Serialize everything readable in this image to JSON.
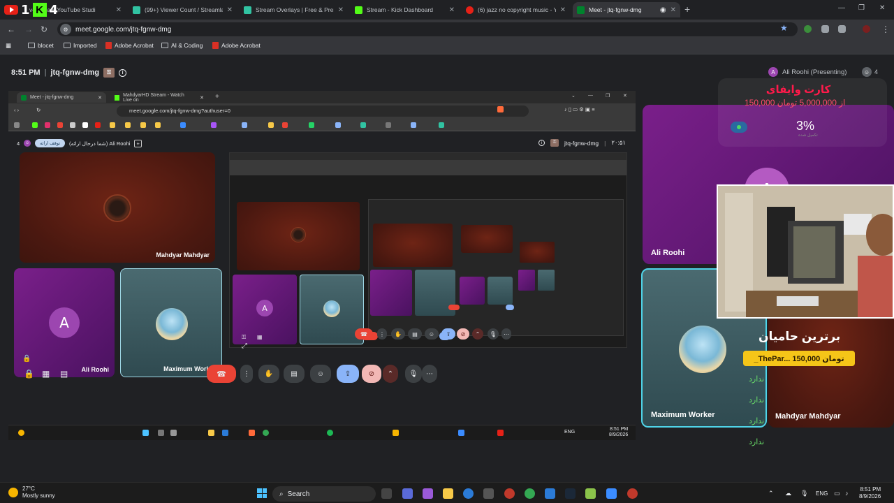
{
  "browser": {
    "tabs": [
      {
        "label": "ve stream YouTube Studi"
      },
      {
        "label": "(99+) Viewer Count / Streamlab"
      },
      {
        "label": "Stream Overlays | Free & Premiu"
      },
      {
        "label": "Stream - Kick Dashboard"
      },
      {
        "label": "(6) jazz no copyright music - Yo"
      },
      {
        "label": "Meet - jtq-fgnw-dmg"
      }
    ],
    "overlay_counts": {
      "youtube": "1",
      "kick": "4"
    },
    "url": "meet.google.com/jtq-fgnw-dmg",
    "bookmarks": [
      {
        "label": "blocet",
        "icon": "folder-icon"
      },
      {
        "label": "Imported",
        "icon": "folder-icon"
      },
      {
        "label": "Adobe Acrobat",
        "icon": "acrobat-icon"
      },
      {
        "label": "AI & Coding",
        "icon": "folder-icon"
      },
      {
        "label": "Adobe Acrobat",
        "icon": "acrobat-icon"
      }
    ]
  },
  "meet": {
    "time": "8:51 PM",
    "code": "jtq-fgnw-dmg",
    "presenting": "Ali Roohi (Presenting)",
    "presenter_initial": "A",
    "participant_count": "4",
    "participants": [
      {
        "name": "Ali Roohi",
        "initial": "A"
      },
      {
        "name": "Maximum Worker"
      },
      {
        "name": "Mahdyar Mahdyar"
      }
    ],
    "share": {
      "tabs": [
        "Meet - jtq-fgnw-dmg",
        "MahdyarHD Stream - Watch Live on"
      ],
      "url": "meet.google.com/jtq-fgnw-dmg?authuser=0",
      "pill": "توقف ارائه",
      "presenting_label": "(شما درحال ارائه) Ali Roohi",
      "count": "4",
      "meeting_code": "jtq-fgnw-dmg",
      "time": "۲۰:۵۱",
      "tiles": [
        "Mahdyar Mahdyar",
        "Ali Roohi",
        "Maximum Worker"
      ],
      "initial": "A",
      "taskbar_time": "8:51 PM",
      "taskbar_date": "8/9/2026",
      "lang": "ENG"
    }
  },
  "overlay": {
    "goal_title": "کارت وایفای",
    "goal_amount": "150,000 از 5,000,000 تومان",
    "goal_percent": "3%",
    "goal_sub": "تکمیل شده",
    "top_title": "برترین حامیان",
    "top_item": "_ThePar... تومان 150,000",
    "none_text": "ندارد"
  },
  "taskbar": {
    "temp": "27°C",
    "weather": "Mostly sunny",
    "search": "Search",
    "lang": "ENG",
    "time": "8:51 PM",
    "date": "8/9/2026"
  },
  "colors": {
    "accent": "#8ab4f8",
    "hangup": "#ea4335",
    "goal_title": "#ff1a4a",
    "supporter": "#f5c518",
    "none": "#6ae06a"
  }
}
